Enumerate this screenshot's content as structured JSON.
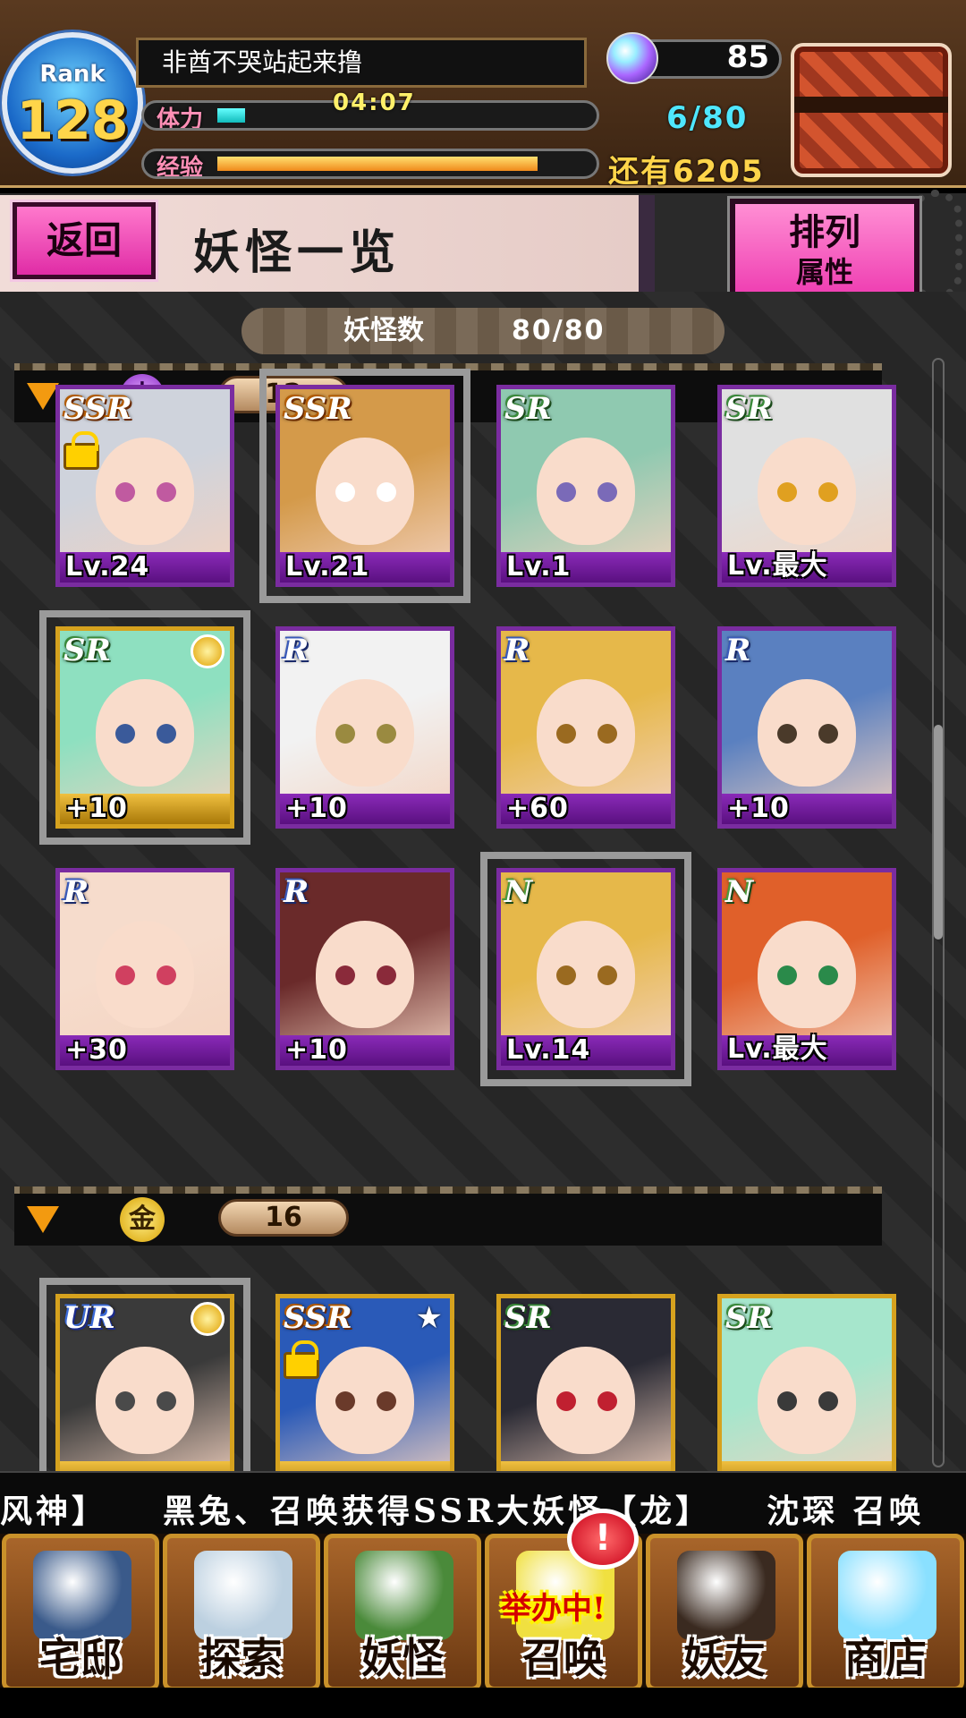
{
  "header": {
    "rank_label": "Rank",
    "rank_value": "128",
    "player_name": "非酋不哭站起来撸",
    "stamina_label": "体力",
    "stamina_timer": "04:07",
    "stamina_count": "6/80",
    "stamina_progress": 0.075,
    "exp_label": "经验",
    "exp_remaining": "还有6205",
    "exp_progress": 0.86,
    "orb_count": "85"
  },
  "title_bar": {
    "back_label": "返回",
    "title": "妖怪一览",
    "sort_label": "排列",
    "sort_mode": "属性"
  },
  "summary": {
    "count_label": "妖怪数",
    "count_value": "80/80"
  },
  "sections": [
    {
      "element_symbol": "土",
      "count": "12",
      "cards": [
        {
          "rarity": "SSR",
          "level": "Lv.24",
          "locked": true,
          "medal": false,
          "selected": false,
          "frame": "purple",
          "hair": "#cfd3dc",
          "eye": "#c05aa0"
        },
        {
          "rarity": "SSR",
          "level": "Lv.21",
          "locked": false,
          "medal": false,
          "selected": true,
          "frame": "purple",
          "hair": "#d49a4a",
          "eye": "#ffffff"
        },
        {
          "rarity": "SR",
          "level": "Lv.1",
          "locked": false,
          "medal": false,
          "selected": false,
          "frame": "purple",
          "hair": "#8fc9b0",
          "eye": "#7a6ab8"
        },
        {
          "rarity": "SR",
          "level": "Lv.最大",
          "locked": false,
          "medal": false,
          "selected": false,
          "frame": "purple",
          "hair": "#e0e0e0",
          "eye": "#e0a020"
        },
        {
          "rarity": "SR",
          "level": "+10",
          "locked": false,
          "medal": true,
          "selected": true,
          "frame": "gold",
          "hair": "#8ee0c0",
          "eye": "#3a5a9a"
        },
        {
          "rarity": "R",
          "level": "+10",
          "locked": false,
          "medal": false,
          "selected": false,
          "frame": "purple",
          "hair": "#f2f2f2",
          "eye": "#9a8a40"
        },
        {
          "rarity": "R",
          "level": "+60",
          "locked": false,
          "medal": false,
          "selected": false,
          "frame": "purple",
          "hair": "#e6b84a",
          "eye": "#9a6a20"
        },
        {
          "rarity": "R",
          "level": "+10",
          "locked": false,
          "medal": false,
          "selected": false,
          "frame": "purple",
          "hair": "#5a80c0",
          "eye": "#4a3a2a"
        },
        {
          "rarity": "R",
          "level": "+30",
          "locked": false,
          "medal": false,
          "selected": false,
          "frame": "purple",
          "hair": "#f6dccc",
          "eye": "#d04060"
        },
        {
          "rarity": "R",
          "level": "+10",
          "locked": false,
          "medal": false,
          "selected": false,
          "frame": "purple",
          "hair": "#6a2a2a",
          "eye": "#8a2a3a"
        },
        {
          "rarity": "N",
          "level": "Lv.14",
          "locked": false,
          "medal": false,
          "selected": true,
          "frame": "purple",
          "hair": "#e6b84a",
          "eye": "#9a6a20"
        },
        {
          "rarity": "N",
          "level": "Lv.最大",
          "locked": false,
          "medal": false,
          "selected": false,
          "frame": "purple",
          "hair": "#e0602a",
          "eye": "#2a8a4a"
        }
      ]
    },
    {
      "element_symbol": "金",
      "count": "16",
      "cards": [
        {
          "rarity": "UR",
          "level": "",
          "locked": false,
          "medal": true,
          "selected": true,
          "frame": "gold",
          "hair": "#3a3a3a",
          "eye": "#4a4a4a"
        },
        {
          "rarity": "SSR",
          "level": "",
          "locked": true,
          "medal": false,
          "selected": false,
          "frame": "gold",
          "star": true,
          "hair": "#2a5ab8",
          "eye": "#6a3a2a"
        },
        {
          "rarity": "SR",
          "level": "",
          "locked": false,
          "medal": false,
          "selected": false,
          "frame": "gold",
          "hair": "#2a2a34",
          "eye": "#c02030"
        },
        {
          "rarity": "SR",
          "level": "",
          "locked": false,
          "medal": false,
          "selected": false,
          "frame": "gold",
          "hair": "#a6e6cc",
          "eye": "#3a3a3a"
        }
      ]
    }
  ],
  "ticker": {
    "text": "风神】　　黑兔、召唤获得SSR大妖怪【龙】　　沈琛 召唤"
  },
  "nav": {
    "items": [
      {
        "label": "宅邸",
        "icon": "mansion-icon",
        "color": "#3a5a8a"
      },
      {
        "label": "探索",
        "icon": "magnifier-icon",
        "color": "#bcd0e0"
      },
      {
        "label": "妖怪",
        "icon": "scroll-icon",
        "color": "#4a8a3a"
      },
      {
        "label": "召唤",
        "icon": "summon-star-icon",
        "color": "#f0e040"
      },
      {
        "label": "妖友",
        "icon": "friend-girl-icon",
        "color": "#3a2a20"
      },
      {
        "label": "商店",
        "icon": "crystal-orb-icon",
        "color": "#8ae0ff"
      }
    ],
    "event_label": "举办中!",
    "notice_badge": "!"
  }
}
